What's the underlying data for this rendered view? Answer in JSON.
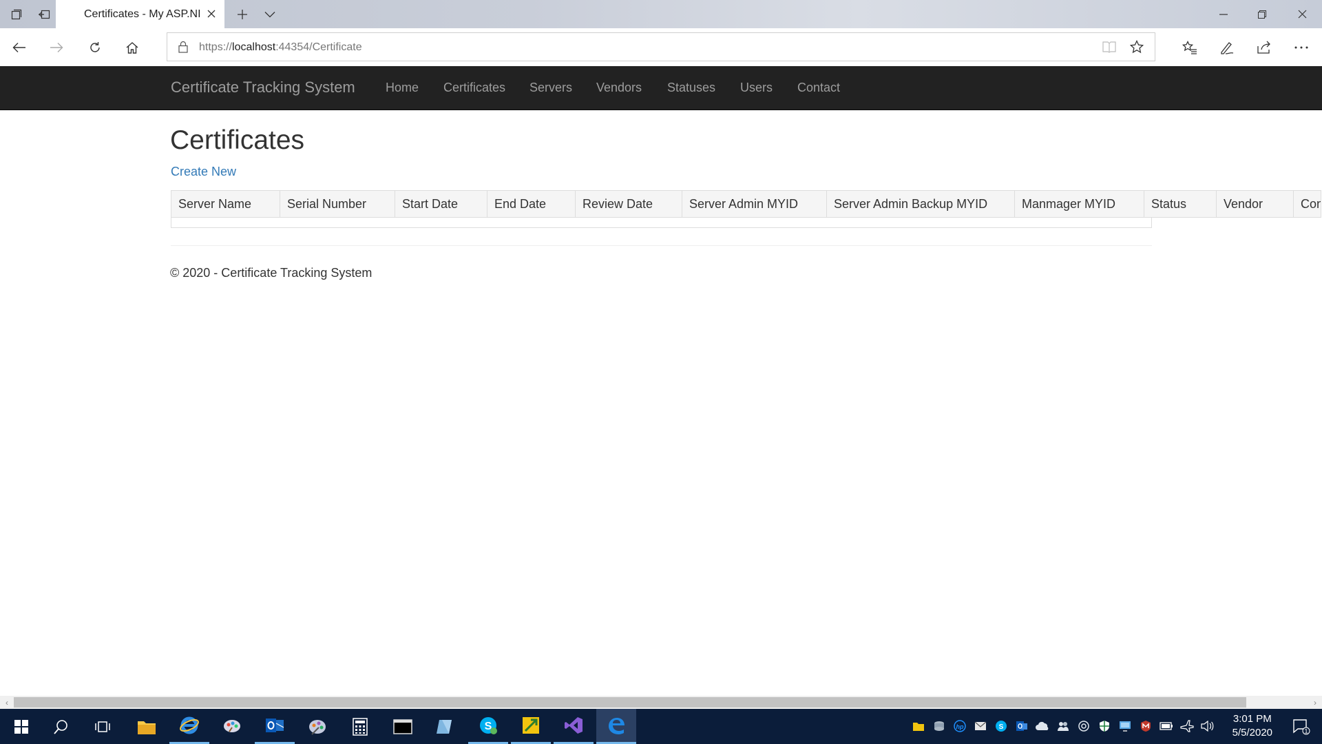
{
  "browser": {
    "tab_title": "Certificates - My ASP.NI",
    "url_scheme": "https://",
    "url_host": "localhost",
    "url_rest": ":44354/Certificate"
  },
  "site": {
    "brand": "Certificate Tracking System",
    "nav": [
      "Home",
      "Certificates",
      "Servers",
      "Vendors",
      "Statuses",
      "Users",
      "Contact"
    ]
  },
  "page": {
    "title": "Certificates",
    "create_new": "Create New",
    "columns": [
      "Server Name",
      "Serial Number",
      "Start Date",
      "End Date",
      "Review Date",
      "Server Admin MYID",
      "Server Admin Backup MYID",
      "Manmager MYID",
      "Status",
      "Vendor",
      "Con"
    ],
    "rows": [],
    "footer": "© 2020 - Certificate Tracking System"
  },
  "taskbar": {
    "time": "3:01 PM",
    "date": "5/5/2020",
    "notification_count": "1"
  },
  "colors": {
    "navbar_bg": "#222222",
    "navbar_text": "#9d9d9d",
    "link": "#337ab7",
    "taskbar_bg": "#0b1d3a"
  }
}
